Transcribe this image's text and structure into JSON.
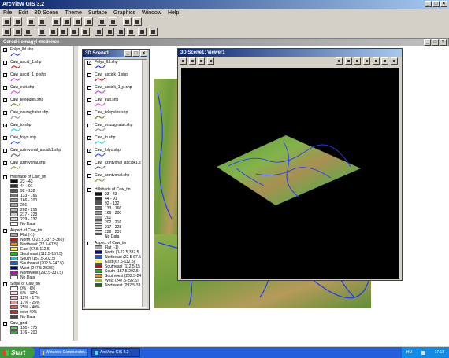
{
  "app": {
    "title": "ArcView GIS 3.2"
  },
  "menu": [
    "File",
    "Edit",
    "3D Scene",
    "Theme",
    "Surface",
    "Graphics",
    "Window",
    "Help"
  ],
  "project_window": {
    "title": "Cered-ilomagyi-medence"
  },
  "themes": {
    "layers": [
      {
        "label": "Folyo_lbl.shp",
        "checked": true,
        "color": "#1a1aff"
      },
      {
        "label": "Caw_ascid_1.shp",
        "checked": false,
        "color": "#c00"
      },
      {
        "label": "Caw_ascid_1_p.shp",
        "checked": false,
        "color": "#b33bd6"
      },
      {
        "label": "Caw_euit.shp",
        "checked": false,
        "color": "#cc44cc"
      },
      {
        "label": "Caw_telepules.shp",
        "checked": false,
        "color": "#6b6b1a"
      },
      {
        "label": "Caw_orszaghatar.shp",
        "checked": false,
        "color": "#888"
      },
      {
        "label": "Caw_to.shp",
        "checked": true,
        "color": "#00d8e8"
      },
      {
        "label": "Caw_folyo.shp",
        "checked": true,
        "color": "#1e3bff"
      },
      {
        "label": "Caw_szintvonal_ascidk1.shp",
        "checked": false,
        "color": "#555"
      },
      {
        "label": "Caw_szintvonal.shp",
        "checked": false,
        "color": "#8a8a40"
      }
    ],
    "hillshade": {
      "label": "Hillshade of Caw_tin",
      "items": [
        [
          "23 - 43",
          "#111"
        ],
        [
          "44 - 91",
          "#333"
        ],
        [
          "92 - 132",
          "#555"
        ],
        [
          "133 - 166",
          "#777"
        ],
        [
          "166 - 200",
          "#999"
        ],
        [
          "201",
          "#aaa"
        ],
        [
          "202 - 216",
          "#bbb"
        ],
        [
          "217 - 228",
          "#ccc"
        ],
        [
          "229 - 237",
          "#ddd"
        ],
        [
          "No Data",
          "#fff"
        ]
      ]
    },
    "aspect": {
      "label": "Aspect of Caw_tin",
      "items": [
        [
          "Flat (-1)",
          "#aaa"
        ],
        [
          "North (0-22.5,337.5-360)",
          "#e00"
        ],
        [
          "Northeast (22.5-67.5)",
          "#f80"
        ],
        [
          "East (67.5-112.5)",
          "#ff0"
        ],
        [
          "Southeast (112.5-157.5)",
          "#0c0"
        ],
        [
          "South (157.5-202.5)",
          "#0cc"
        ],
        [
          "Southwest (202.5-247.5)",
          "#06f"
        ],
        [
          "West (247.5-292.5)",
          "#00a"
        ],
        [
          "Northwest (292.5-337.5)",
          "#c0c"
        ],
        [
          "No Data",
          "#fff"
        ]
      ]
    },
    "slope": {
      "label": "Slope of Caw_tin",
      "items": [
        [
          "0% - 6%",
          "#fff"
        ],
        [
          "6% - 12%",
          "#fde"
        ],
        [
          "12% - 17%",
          "#fbb"
        ],
        [
          "17% - 25%",
          "#f88"
        ],
        [
          "25% - 40%",
          "#e55"
        ],
        [
          "over 40%",
          "#c22"
        ],
        [
          "No Data",
          "#444"
        ]
      ]
    },
    "grid": {
      "label": "Caw_grid",
      "items": [
        [
          "150 - 175",
          "#6c6"
        ],
        [
          "176 - 200",
          "#3a3"
        ]
      ]
    }
  },
  "scene_window": {
    "title": "3D Scene1"
  },
  "scene_themes": {
    "layers": [
      {
        "label": "Folyo_lbl.shp",
        "checked": true,
        "color": "#1a1aff"
      },
      {
        "label": "Caw_ascidk_1.shp",
        "checked": false,
        "color": "#c00"
      },
      {
        "label": "Caw_ascidk_1_p.shp",
        "checked": false,
        "color": "#b33bd6"
      },
      {
        "label": "Caw_euit.shp",
        "checked": false,
        "color": "#cc44cc"
      },
      {
        "label": "Caw_telepules.shp",
        "checked": false,
        "color": "#6b6b1a"
      },
      {
        "label": "Caw_orszaghatar.shp",
        "checked": false,
        "color": "#888"
      },
      {
        "label": "Caw_to.shp",
        "checked": true,
        "color": "#00d8e8"
      },
      {
        "label": "Caw_folyo.shp",
        "checked": true,
        "color": "#1e3bff"
      },
      {
        "label": "Caw_szintvonal_ascidk1.s",
        "checked": false,
        "color": "#555"
      },
      {
        "label": "Caw_szintvonal.shp",
        "checked": false,
        "color": "#8a8a40"
      }
    ],
    "hillshade": {
      "label": "Hillshade of Caw_tin",
      "items": [
        [
          "23 - 43",
          "#111"
        ],
        [
          "44 - 91",
          "#333"
        ],
        [
          "92 - 132",
          "#555"
        ],
        [
          "133 - 166",
          "#777"
        ],
        [
          "166 - 200",
          "#999"
        ],
        [
          "201",
          "#aaa"
        ],
        [
          "202 - 216",
          "#bbb"
        ],
        [
          "217 - 228",
          "#ccc"
        ],
        [
          "229 - 237",
          "#ddd"
        ],
        [
          "No Data",
          "#fff"
        ]
      ]
    },
    "aspect": {
      "label": "Aspect of Caw_tin",
      "items": [
        [
          "Flat (-1)",
          "#aaa"
        ],
        [
          "North (0-22.5,337.5",
          "#00c"
        ],
        [
          "Northeast (22.5-67.5",
          "#06f"
        ],
        [
          "East (67.5-112.5)",
          "#ff0"
        ],
        [
          "Southeast (112.5-15",
          "#e00"
        ],
        [
          "South (157.5-202.5",
          "#0c0"
        ],
        [
          "Southwest (202.5-24",
          "#f80"
        ],
        [
          "West (247.5-292.5)",
          "#9c0"
        ],
        [
          "Northwest (292.5-33",
          "#070"
        ]
      ]
    }
  },
  "viewer": {
    "title": "3D Scene1: Viewer1"
  },
  "taskbar": {
    "start": "Start",
    "tasks": [
      "Windows Commander...",
      "ArcView GIS 3.2"
    ],
    "clock": "17:13",
    "lang": "HU"
  }
}
